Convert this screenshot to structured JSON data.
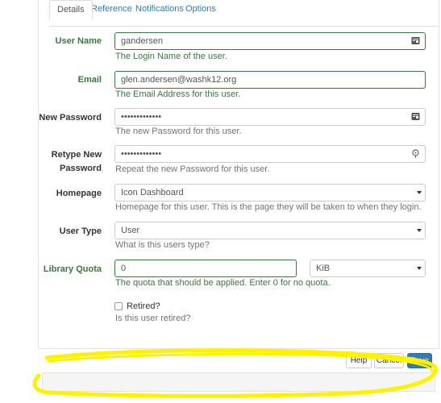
{
  "tabs": [
    {
      "label": "Details",
      "active": true
    },
    {
      "label": "Reference",
      "active": false
    },
    {
      "label": "Notifications",
      "active": false
    },
    {
      "label": "Options",
      "active": false
    }
  ],
  "form": {
    "user_name": {
      "label": "User Name",
      "value": "gandersen",
      "help": "The Login Name of the user."
    },
    "email": {
      "label": "Email",
      "value": "glen.andersen@washk12.org",
      "help": "The Email Address for this user."
    },
    "new_password": {
      "label": "New Password",
      "value": "•••••••••••••",
      "help": "The new Password for this user."
    },
    "retype_password": {
      "label_line1": "Retype New",
      "label_line2": "Password",
      "value": "•••••••••••••",
      "help": "Repeat the new Password for this user."
    },
    "homepage": {
      "label": "Homepage",
      "value": "Icon Dashboard",
      "help": "Homepage for this user. This is the page they will be taken to when they login."
    },
    "user_type": {
      "label": "User Type",
      "value": "User",
      "help": "What is this users type?"
    },
    "library_quota": {
      "label": "Library Quota",
      "value": "0",
      "unit": "KiB",
      "help": "The quota that should be applied. Enter 0 for no quota."
    },
    "retired": {
      "label": "Retired?",
      "checked": false,
      "help": "Is this user retired?"
    }
  },
  "buttons": {
    "help": "Help",
    "cancel": "Cancel",
    "save": "Save"
  },
  "colors": {
    "valid": "#3c763d",
    "primary": "#337ab7",
    "highlight": "#fff200"
  }
}
